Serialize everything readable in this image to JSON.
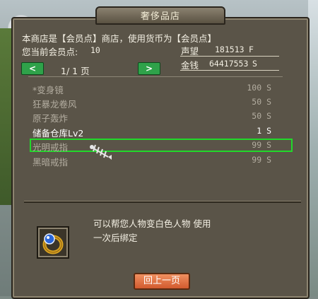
{
  "window": {
    "title": "奢侈品店"
  },
  "info": {
    "store_line": "本商店是【会员点】商店，使用货币为【会员点】",
    "points_label": "您当前会员点:",
    "points_value": "10",
    "reputation_label": "声望",
    "reputation_value": "181513",
    "reputation_unit": "F",
    "money_label": "金钱",
    "money_value": "64417553",
    "money_unit": "S"
  },
  "pager": {
    "prev_icon": "arrow-left",
    "next_icon": "arrow-right",
    "text": "1/ 1 页"
  },
  "items": [
    {
      "name": "*变身镜",
      "price": "100 S",
      "state": "dim"
    },
    {
      "name": "狂暴龙卷风",
      "price": "50 S",
      "state": "dim"
    },
    {
      "name": "原子轰炸",
      "price": "50 S",
      "state": "dim"
    },
    {
      "name": "储备仓库Lv2",
      "price": "1 S",
      "state": "bright"
    },
    {
      "name": "光明戒指",
      "price": "99 S",
      "state": "selected"
    },
    {
      "name": "黑暗戒指",
      "price": "99 S",
      "state": "dim"
    }
  ],
  "description": {
    "line1": "可以帮您人物变白色人物 使用",
    "line2": "一次后绑定",
    "item_icon": "ring-icon"
  },
  "footer": {
    "back_label": "回上一页"
  },
  "colors": {
    "selection": "#21d92a",
    "pager_button": "#2fa24a",
    "back_button": "#d25a2e"
  }
}
